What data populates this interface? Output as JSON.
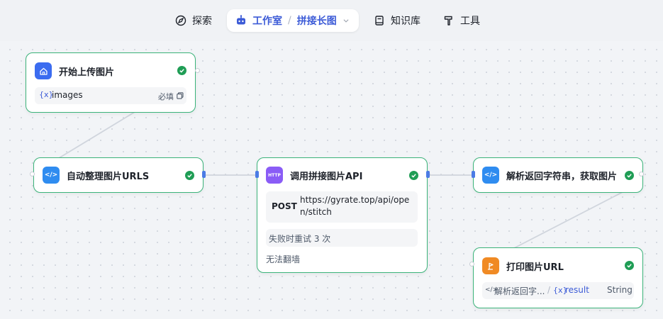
{
  "nav": {
    "explore": "探索",
    "studio": "工作室",
    "separator": "/",
    "project": "拼接长图",
    "knowledge": "知识库",
    "tools": "工具"
  },
  "nodes": {
    "start": {
      "title": "开始上传图片",
      "var_symbol": "{x}",
      "var_name": "images",
      "required": "必填"
    },
    "code1": {
      "title": "自动整理图片URLS",
      "icon": "</>"
    },
    "http": {
      "title": "调用拼接图片API",
      "icon": "HTTP",
      "method": "POST",
      "url_line1": "https://gyrate.top/api/ope",
      "url_line2": "n/stitch",
      "retry": "失败时重试 3 次",
      "note": "无法翻墙"
    },
    "code2": {
      "title": "解析返回字符串，获取图片U",
      "icon": "</>"
    },
    "output": {
      "title": "打印图片URL",
      "source": "解析返回字...",
      "divider": "/",
      "var_symbol": "{x}",
      "var_name": "result",
      "type": "String"
    }
  },
  "colors": {
    "accent": "#3c5bd7",
    "node_border": "#3bb37a",
    "check": "#1f9d55",
    "start_icon": "#3b6cf0",
    "code_icon": "#2f8cf0",
    "http_icon": "#8a5cf6",
    "output_icon": "#f08a24"
  }
}
